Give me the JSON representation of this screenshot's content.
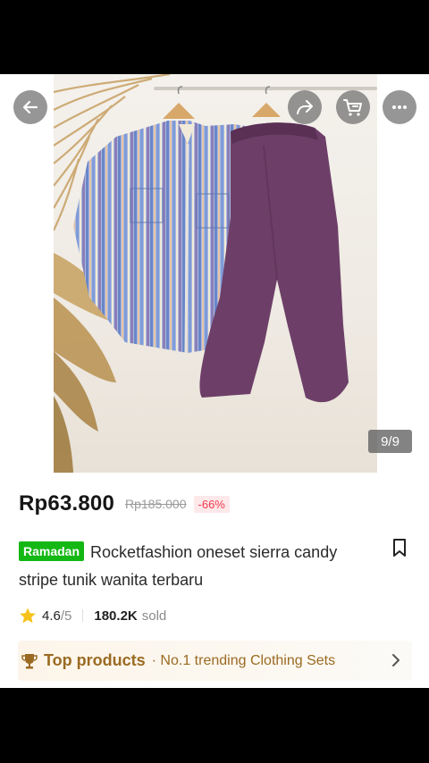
{
  "gallery": {
    "counter": "9/9",
    "icons": [
      "back-arrow-icon",
      "share-icon",
      "cart-icon",
      "more-icon"
    ]
  },
  "product": {
    "price": "Rp63.800",
    "original_price": "Rp185.000",
    "discount": "-66%",
    "badge": "Ramadan",
    "title": "Rocketfashion oneset sierra candy stripe tunik wanita terbaru",
    "rating": "4.6",
    "rating_max": "/5",
    "sold_count": "180.2K",
    "sold_label": "sold"
  },
  "top_products": {
    "title": "Top products",
    "subtitle": "· No.1 trending Clothing Sets"
  },
  "colors": {
    "price": "#161616",
    "discount": "#f23a4f",
    "badge": "#14b814",
    "top_products_text": "#9b6a22"
  }
}
